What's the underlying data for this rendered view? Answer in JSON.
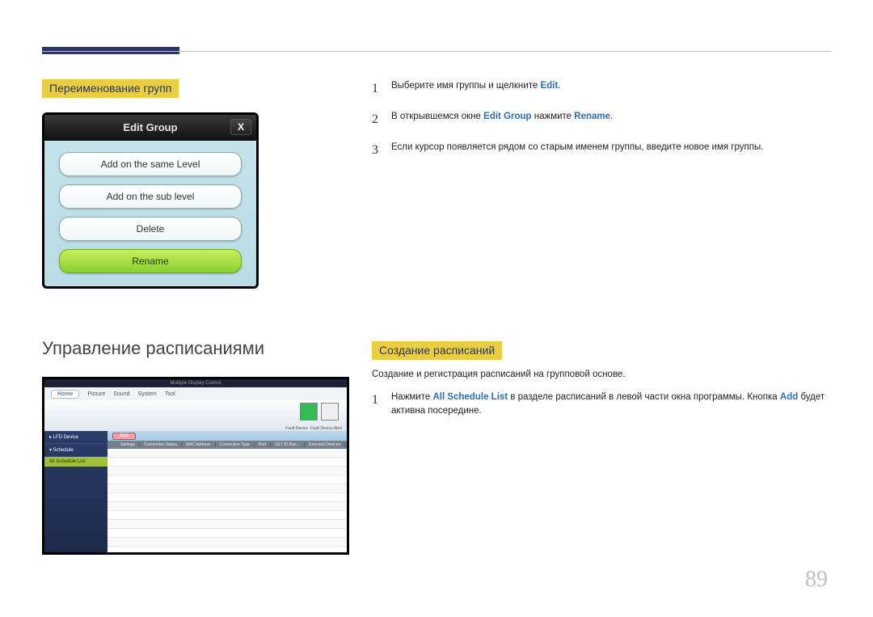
{
  "page_number": "89",
  "section1": {
    "heading": "Переименование групп",
    "dialog": {
      "title": "Edit Group",
      "btn_same": "Add on the same Level",
      "btn_sub": "Add on the sub level",
      "btn_delete": "Delete",
      "btn_rename": "Rename"
    },
    "steps": {
      "s1_a": "Выберите имя группы и щелкните ",
      "s1_b": "Edit",
      "s1_c": ".",
      "s2_a": "В открывшемся окне ",
      "s2_b": "Edit Group",
      "s2_c": " нажмите ",
      "s2_d": "Rename",
      "s2_e": ".",
      "s3": "Если курсор появляется рядом со старым именем группы, введите новое имя группы."
    }
  },
  "section2": {
    "heading_main": "Управление расписаниями",
    "heading_sub": "Создание расписаний",
    "body": "Создание и регистрация расписаний на групповой основе.",
    "steps": {
      "s1_a": "Нажмите ",
      "s1_b": "All Schedule List",
      "s1_c": " в разделе расписаний в левой части окна программы. Кнопка ",
      "s1_d": "Add",
      "s1_e": " будет активна посередине."
    },
    "mdc": {
      "title": "Multiple Display Control",
      "menu": [
        "Home",
        "Picture",
        "Sound",
        "System",
        "Tool"
      ],
      "ribbon_lbl1": "Fault Device",
      "ribbon_lbl2": "Fault Device Alert",
      "side_lfd": "▸ LFD Device",
      "side_sched": "▾ Schedule",
      "side_all": "All Schedule List",
      "add": "Add",
      "cols": [
        "",
        "Settings",
        "Connection Status",
        "MAC Address",
        "Connection Type",
        "Port",
        "SET ID Ran...",
        "Detected Devices"
      ]
    }
  }
}
